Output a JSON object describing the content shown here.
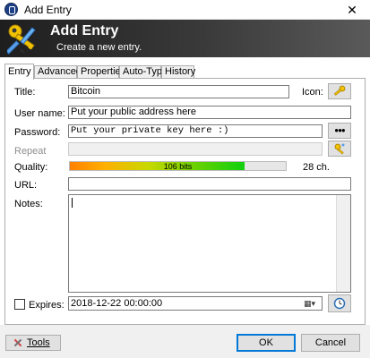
{
  "window": {
    "title": "Add Entry",
    "close_glyph": "✕"
  },
  "banner": {
    "title": "Add Entry",
    "subtitle": "Create a new entry.",
    "icon": "key-pencil-icon"
  },
  "tabs": [
    {
      "label": "Entry",
      "active": true
    },
    {
      "label": "Advanced",
      "active": false
    },
    {
      "label": "Properties",
      "active": false
    },
    {
      "label": "Auto-Type",
      "active": false
    },
    {
      "label": "History",
      "active": false
    }
  ],
  "form": {
    "title_label": "Title:",
    "title_value": "Bitcoin",
    "icon_label": "Icon:",
    "username_label": "User name:",
    "username_value": "Put your public address here",
    "password_label": "Password:",
    "password_value": "Put your private key here :)",
    "password_toggle_glyph": "●●●",
    "repeat_label": "Repeat",
    "quality_label": "Quality:",
    "quality_bits": "106 bits",
    "quality_fraction": 0.81,
    "quality_chars": "28 ch.",
    "url_label": "URL:",
    "url_value": "",
    "notes_label": "Notes:",
    "expires_label": "Expires:",
    "expires_value": "2018-12-22 00:00:00",
    "expires_checked": false
  },
  "footer": {
    "tools_label": "Tools",
    "ok_label": "OK",
    "cancel_label": "Cancel"
  },
  "colors": {
    "banner_dark": "#1e1e1e",
    "quality_start": "#ff8000",
    "quality_end": "#10d010"
  }
}
